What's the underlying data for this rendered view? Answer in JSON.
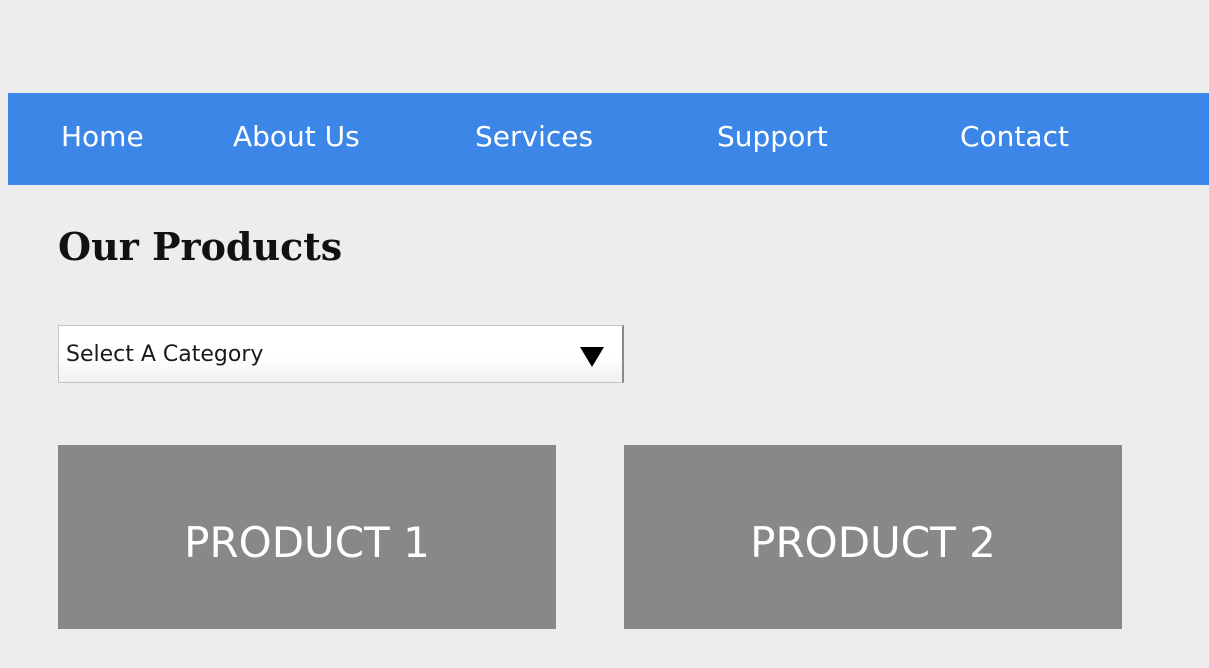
{
  "nav": {
    "items": [
      {
        "label": "Home"
      },
      {
        "label": "About Us"
      },
      {
        "label": "Services"
      },
      {
        "label": "Support"
      },
      {
        "label": "Contact"
      }
    ]
  },
  "main": {
    "title": "Our Products",
    "category_select": {
      "value": "Select A Category",
      "icon": "triangle-down-icon"
    },
    "products": [
      {
        "label": "PRODUCT 1"
      },
      {
        "label": "PRODUCT 2"
      }
    ]
  },
  "colors": {
    "page_background": "#ededed",
    "navbar": "#3b86e6",
    "nav_text": "#ffffff",
    "product_card": "#888888",
    "product_text": "#ffffff"
  }
}
